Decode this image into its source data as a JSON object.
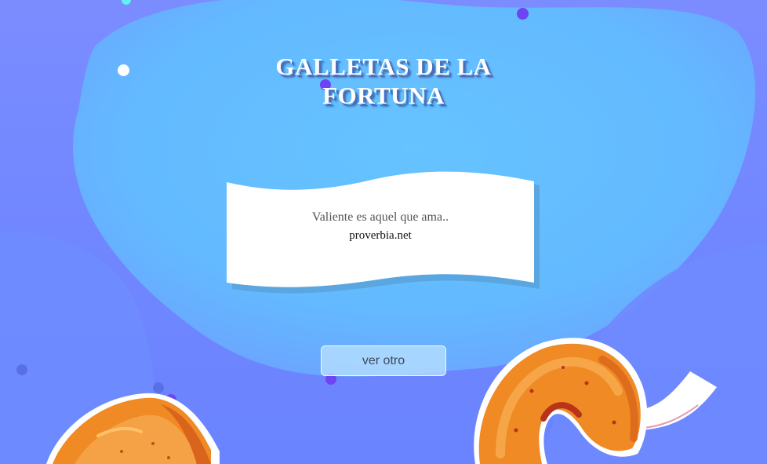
{
  "title": {
    "line1": "GALLETAS DE LA",
    "line2": "FORTUNA"
  },
  "fortune": {
    "quote": "Valiente es aquel que ama..",
    "source": "proverbia.net"
  },
  "actions": {
    "next_label": "ver otro"
  },
  "colors": {
    "background": "#6f86ff",
    "blob_light": "#66c2ff",
    "paper": "#ffffff",
    "paper_shadow": "#5aa6e0",
    "cookie_orange": "#f08a24",
    "dot_purple": "#6f44f2",
    "dot_cyan": "#5ff0f0"
  },
  "decorations": {
    "left_cookie_icon": "fortune-cookie-icon",
    "right_cookie_icon": "fortune-cookie-icon"
  }
}
